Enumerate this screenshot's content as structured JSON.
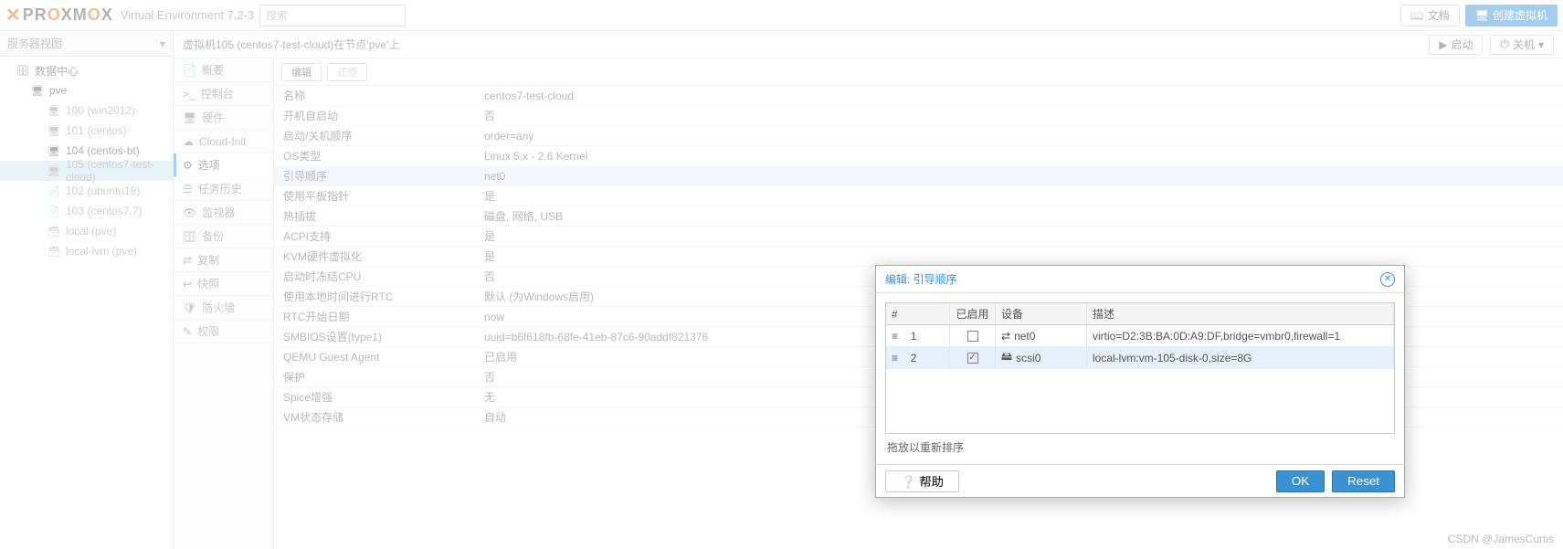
{
  "top": {
    "product": "PROXMOX",
    "subtitle": "Virtual Environment 7.2-3",
    "search_ph": "搜索",
    "docs": "文档",
    "create_vm": "创建虚拟机"
  },
  "sidebar": {
    "header": "服务器视图",
    "items": [
      {
        "label": "数据中心",
        "icon": "🗄",
        "indent": 0
      },
      {
        "label": "pve",
        "icon": "🖥",
        "indent": 1,
        "green": true
      },
      {
        "label": "100 (win2012)",
        "icon": "🖥",
        "indent": 2,
        "faded": true
      },
      {
        "label": "101 (centos)",
        "icon": "🖥",
        "indent": 2,
        "faded": true
      },
      {
        "label": "104 (centos-bt)",
        "icon": "🖥",
        "indent": 2
      },
      {
        "label": "105 (centos7-test-cloud)",
        "icon": "🖥",
        "indent": 2,
        "sel": true,
        "faded": true
      },
      {
        "label": "102 (ubuntu18)",
        "icon": "📄",
        "indent": 2,
        "faded": true
      },
      {
        "label": "103 (centos7.7)",
        "icon": "📄",
        "indent": 2,
        "faded": true
      },
      {
        "label": "local (pve)",
        "icon": "🗃",
        "indent": 2,
        "faded": true
      },
      {
        "label": "local-lvm (pve)",
        "icon": "🗃",
        "indent": 2,
        "faded": true
      }
    ]
  },
  "header": {
    "title": "虚拟机105 (centos7-test-cloud)在节点'pve'上",
    "start": "启动",
    "shutdown": "关机"
  },
  "inner_nav": [
    {
      "label": "概要",
      "icon": "📄"
    },
    {
      "label": "控制台",
      "icon": ">_"
    },
    {
      "label": "硬件",
      "icon": "🖥"
    },
    {
      "label": "Cloud-Init",
      "icon": "☁"
    },
    {
      "label": "选项",
      "icon": "⚙",
      "sel": true
    },
    {
      "label": "任务历史",
      "icon": "☰"
    },
    {
      "label": "监视器",
      "icon": "👁"
    },
    {
      "label": "备份",
      "icon": "🗄"
    },
    {
      "label": "复制",
      "icon": "⇄"
    },
    {
      "label": "快照",
      "icon": "↩"
    },
    {
      "label": "防火墙",
      "icon": "🛡"
    },
    {
      "label": "权限",
      "icon": "✎"
    }
  ],
  "toolbar": {
    "edit": "编辑",
    "revert": "还原"
  },
  "options": [
    {
      "k": "名称",
      "v": "centos7-test-cloud"
    },
    {
      "k": "开机自启动",
      "v": "否"
    },
    {
      "k": "启动/关机顺序",
      "v": "order=any"
    },
    {
      "k": "OS类型",
      "v": "Linux 5.x - 2.6 Kernel"
    },
    {
      "k": "引导顺序",
      "v": "net0",
      "sel": true
    },
    {
      "k": "使用平板指针",
      "v": "是"
    },
    {
      "k": "热插拔",
      "v": "磁盘, 网络, USB"
    },
    {
      "k": "ACPI支持",
      "v": "是"
    },
    {
      "k": "KVM硬件虚拟化",
      "v": "是"
    },
    {
      "k": "启动时冻结CPU",
      "v": "否"
    },
    {
      "k": "使用本地时间进行RTC",
      "v": "默认 (为Windows启用)"
    },
    {
      "k": "RTC开始日期",
      "v": "now"
    },
    {
      "k": "SMBIOS设置(type1)",
      "v": "uuid=b6f618fb-68fe-41eb-87c6-90addf821376"
    },
    {
      "k": "QEMU Guest Agent",
      "v": "已启用"
    },
    {
      "k": "保护",
      "v": "否"
    },
    {
      "k": "Spice增强",
      "v": "无"
    },
    {
      "k": "VM状态存储",
      "v": "自动"
    }
  ],
  "dialog": {
    "title": "编辑: 引导顺序",
    "cols": {
      "num": "#",
      "enabled": "已启用",
      "device": "设备",
      "desc": "描述"
    },
    "rows": [
      {
        "n": "1",
        "en": false,
        "icon": "⇄",
        "dev": "net0",
        "desc": "virtio=D2:3B:BA:0D:A9:DF,bridge=vmbr0,firewall=1"
      },
      {
        "n": "2",
        "en": true,
        "icon": "🖴",
        "dev": "scsi0",
        "desc": "local-lvm:vm-105-disk-0,size=8G",
        "sel": true
      }
    ],
    "hint": "拖放以重新排序",
    "help": "帮助",
    "ok": "OK",
    "reset": "Reset"
  },
  "watermark": "CSDN @JamesCurtis"
}
